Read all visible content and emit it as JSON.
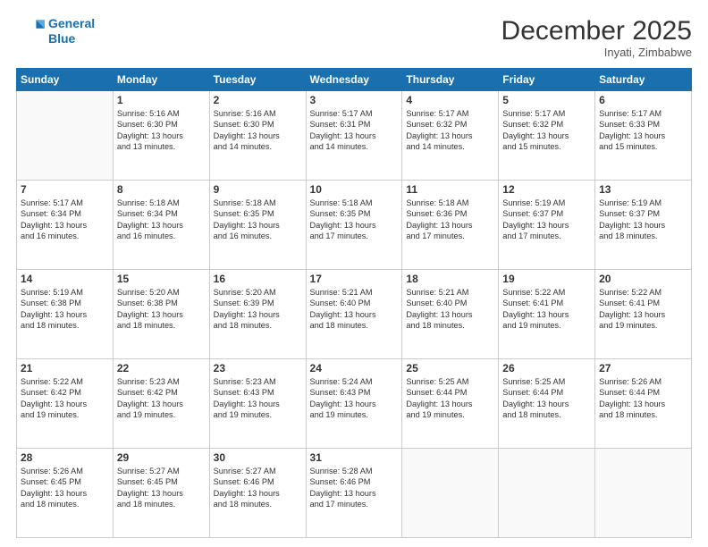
{
  "header": {
    "logo_line1": "General",
    "logo_line2": "Blue",
    "month": "December 2025",
    "location": "Inyati, Zimbabwe"
  },
  "weekdays": [
    "Sunday",
    "Monday",
    "Tuesday",
    "Wednesday",
    "Thursday",
    "Friday",
    "Saturday"
  ],
  "weeks": [
    [
      {
        "day": "",
        "info": ""
      },
      {
        "day": "1",
        "info": "Sunrise: 5:16 AM\nSunset: 6:30 PM\nDaylight: 13 hours\nand 13 minutes."
      },
      {
        "day": "2",
        "info": "Sunrise: 5:16 AM\nSunset: 6:30 PM\nDaylight: 13 hours\nand 14 minutes."
      },
      {
        "day": "3",
        "info": "Sunrise: 5:17 AM\nSunset: 6:31 PM\nDaylight: 13 hours\nand 14 minutes."
      },
      {
        "day": "4",
        "info": "Sunrise: 5:17 AM\nSunset: 6:32 PM\nDaylight: 13 hours\nand 14 minutes."
      },
      {
        "day": "5",
        "info": "Sunrise: 5:17 AM\nSunset: 6:32 PM\nDaylight: 13 hours\nand 15 minutes."
      },
      {
        "day": "6",
        "info": "Sunrise: 5:17 AM\nSunset: 6:33 PM\nDaylight: 13 hours\nand 15 minutes."
      }
    ],
    [
      {
        "day": "7",
        "info": "Sunrise: 5:17 AM\nSunset: 6:34 PM\nDaylight: 13 hours\nand 16 minutes."
      },
      {
        "day": "8",
        "info": "Sunrise: 5:18 AM\nSunset: 6:34 PM\nDaylight: 13 hours\nand 16 minutes."
      },
      {
        "day": "9",
        "info": "Sunrise: 5:18 AM\nSunset: 6:35 PM\nDaylight: 13 hours\nand 16 minutes."
      },
      {
        "day": "10",
        "info": "Sunrise: 5:18 AM\nSunset: 6:35 PM\nDaylight: 13 hours\nand 17 minutes."
      },
      {
        "day": "11",
        "info": "Sunrise: 5:18 AM\nSunset: 6:36 PM\nDaylight: 13 hours\nand 17 minutes."
      },
      {
        "day": "12",
        "info": "Sunrise: 5:19 AM\nSunset: 6:37 PM\nDaylight: 13 hours\nand 17 minutes."
      },
      {
        "day": "13",
        "info": "Sunrise: 5:19 AM\nSunset: 6:37 PM\nDaylight: 13 hours\nand 18 minutes."
      }
    ],
    [
      {
        "day": "14",
        "info": "Sunrise: 5:19 AM\nSunset: 6:38 PM\nDaylight: 13 hours\nand 18 minutes."
      },
      {
        "day": "15",
        "info": "Sunrise: 5:20 AM\nSunset: 6:38 PM\nDaylight: 13 hours\nand 18 minutes."
      },
      {
        "day": "16",
        "info": "Sunrise: 5:20 AM\nSunset: 6:39 PM\nDaylight: 13 hours\nand 18 minutes."
      },
      {
        "day": "17",
        "info": "Sunrise: 5:21 AM\nSunset: 6:40 PM\nDaylight: 13 hours\nand 18 minutes."
      },
      {
        "day": "18",
        "info": "Sunrise: 5:21 AM\nSunset: 6:40 PM\nDaylight: 13 hours\nand 18 minutes."
      },
      {
        "day": "19",
        "info": "Sunrise: 5:22 AM\nSunset: 6:41 PM\nDaylight: 13 hours\nand 19 minutes."
      },
      {
        "day": "20",
        "info": "Sunrise: 5:22 AM\nSunset: 6:41 PM\nDaylight: 13 hours\nand 19 minutes."
      }
    ],
    [
      {
        "day": "21",
        "info": "Sunrise: 5:22 AM\nSunset: 6:42 PM\nDaylight: 13 hours\nand 19 minutes."
      },
      {
        "day": "22",
        "info": "Sunrise: 5:23 AM\nSunset: 6:42 PM\nDaylight: 13 hours\nand 19 minutes."
      },
      {
        "day": "23",
        "info": "Sunrise: 5:23 AM\nSunset: 6:43 PM\nDaylight: 13 hours\nand 19 minutes."
      },
      {
        "day": "24",
        "info": "Sunrise: 5:24 AM\nSunset: 6:43 PM\nDaylight: 13 hours\nand 19 minutes."
      },
      {
        "day": "25",
        "info": "Sunrise: 5:25 AM\nSunset: 6:44 PM\nDaylight: 13 hours\nand 19 minutes."
      },
      {
        "day": "26",
        "info": "Sunrise: 5:25 AM\nSunset: 6:44 PM\nDaylight: 13 hours\nand 18 minutes."
      },
      {
        "day": "27",
        "info": "Sunrise: 5:26 AM\nSunset: 6:44 PM\nDaylight: 13 hours\nand 18 minutes."
      }
    ],
    [
      {
        "day": "28",
        "info": "Sunrise: 5:26 AM\nSunset: 6:45 PM\nDaylight: 13 hours\nand 18 minutes."
      },
      {
        "day": "29",
        "info": "Sunrise: 5:27 AM\nSunset: 6:45 PM\nDaylight: 13 hours\nand 18 minutes."
      },
      {
        "day": "30",
        "info": "Sunrise: 5:27 AM\nSunset: 6:46 PM\nDaylight: 13 hours\nand 18 minutes."
      },
      {
        "day": "31",
        "info": "Sunrise: 5:28 AM\nSunset: 6:46 PM\nDaylight: 13 hours\nand 17 minutes."
      },
      {
        "day": "",
        "info": ""
      },
      {
        "day": "",
        "info": ""
      },
      {
        "day": "",
        "info": ""
      }
    ]
  ]
}
